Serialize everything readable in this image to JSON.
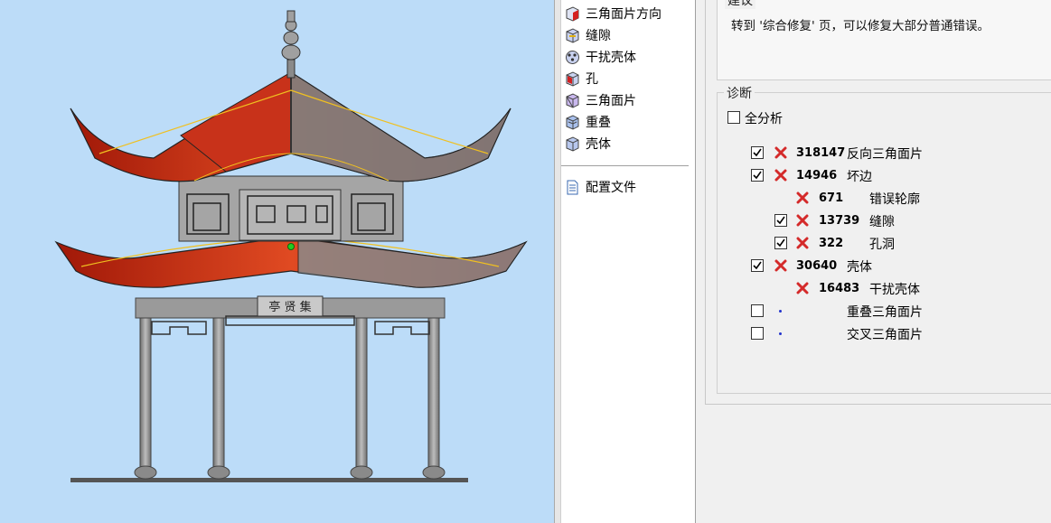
{
  "viewport": {
    "model_icon": "pavilion-model",
    "plaque_text": "亭 贤 集",
    "colors": {
      "background": "#bcdcf8",
      "roof_red": "#d63a1c",
      "roof_gray": "#8a8a8a",
      "highlight": "#f0c020"
    }
  },
  "tree": {
    "items": [
      {
        "label": "三角面片方向",
        "icon": "triangle-orientation-icon"
      },
      {
        "label": "缝隙",
        "icon": "gap-icon"
      },
      {
        "label": "干扰壳体",
        "icon": "intersecting-shell-icon"
      },
      {
        "label": "孔",
        "icon": "hole-icon"
      },
      {
        "label": "三角面片",
        "icon": "triangle-icon"
      },
      {
        "label": "重叠",
        "icon": "overlap-icon"
      },
      {
        "label": "壳体",
        "icon": "shell-icon"
      }
    ],
    "profile": {
      "label": "配置文件",
      "icon": "document-icon"
    }
  },
  "suggest": {
    "title": "建议",
    "text": "转到 '综合修复' 页，可以修复大部分普通错误。"
  },
  "diagnose": {
    "title": "诊断",
    "full_analysis": {
      "label": "全分析",
      "checked": false
    },
    "rows": [
      {
        "checked": true,
        "status": "error",
        "count": "318147",
        "label": "反向三角面片"
      },
      {
        "checked": true,
        "status": "error",
        "count": "14946",
        "label": "坏边"
      },
      {
        "checked": null,
        "status": "error",
        "count": "671",
        "label": "错误轮廓"
      },
      {
        "checked": true,
        "status": "error",
        "count": "13739",
        "label": "缝隙"
      },
      {
        "checked": true,
        "status": "error",
        "count": "322",
        "label": "孔洞"
      },
      {
        "checked": true,
        "status": "error",
        "count": "30640",
        "label": "壳体"
      },
      {
        "checked": null,
        "status": "error",
        "count": "16483",
        "label": "干扰壳体"
      },
      {
        "checked": false,
        "status": "none",
        "count": "",
        "label": "重叠三角面片"
      },
      {
        "checked": false,
        "status": "none",
        "count": "",
        "label": "交叉三角面片"
      }
    ],
    "colors": {
      "error": "#d42a2a",
      "none_dot": "#2233cc"
    }
  }
}
